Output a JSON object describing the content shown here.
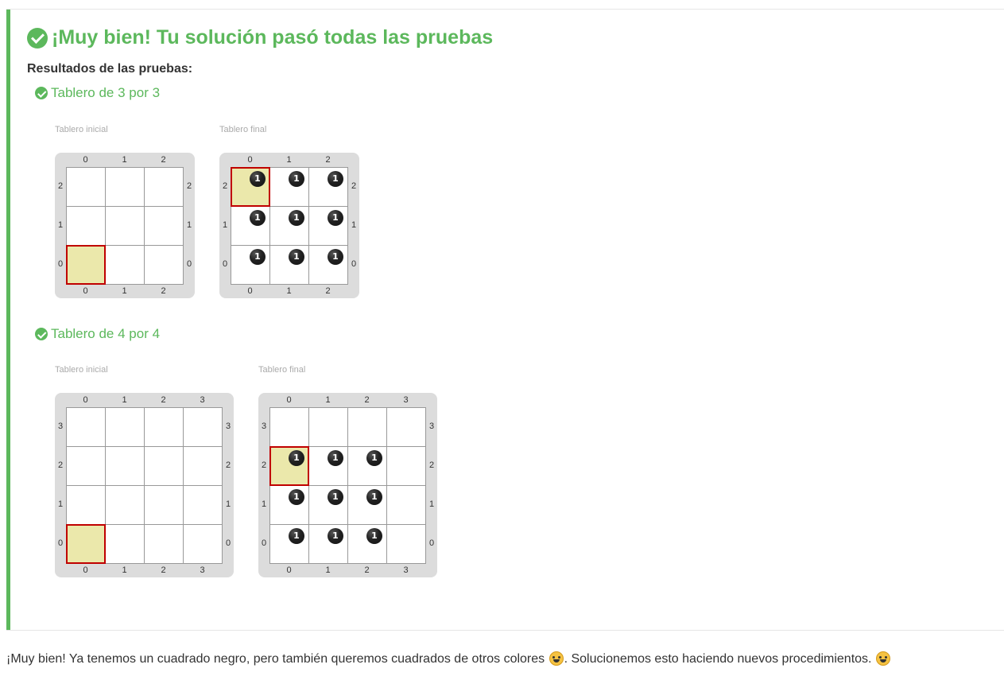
{
  "result": {
    "title": "¡Muy bien! Tu solución pasó todas las pruebas",
    "results_heading": "Resultados de las pruebas:",
    "accent_color": "#5cb85c"
  },
  "tests": [
    {
      "title": "Tablero de 3 por 3",
      "initial_label": "Tablero inicial",
      "final_label": "Tablero final",
      "size": 3,
      "initial_board": {
        "head": [
          0,
          0
        ],
        "balls": []
      },
      "final_board": {
        "head": [
          0,
          2
        ],
        "balls": [
          [
            0,
            2
          ],
          [
            1,
            2
          ],
          [
            2,
            2
          ],
          [
            0,
            1
          ],
          [
            1,
            1
          ],
          [
            2,
            1
          ],
          [
            0,
            0
          ],
          [
            1,
            0
          ],
          [
            2,
            0
          ]
        ],
        "ball_count": "1"
      }
    },
    {
      "title": "Tablero de 4 por 4",
      "initial_label": "Tablero inicial",
      "final_label": "Tablero final",
      "size": 4,
      "initial_board": {
        "head": [
          0,
          0
        ],
        "balls": []
      },
      "final_board": {
        "head": [
          0,
          2
        ],
        "balls": [
          [
            0,
            2
          ],
          [
            1,
            2
          ],
          [
            2,
            2
          ],
          [
            0,
            1
          ],
          [
            1,
            1
          ],
          [
            2,
            1
          ],
          [
            0,
            0
          ],
          [
            1,
            0
          ],
          [
            2,
            0
          ]
        ],
        "ball_count": "1"
      }
    }
  ],
  "colors": {
    "head_cell": "#ebe8ab",
    "head_border": "#c00000",
    "board_frame": "#dcdcdc"
  },
  "footer": {
    "text_before": "¡Muy bien! Ya tenemos un cuadrado negro, pero también queremos cuadrados de otros colores ",
    "emoji_1": "grinning-sweat-emoji",
    "text_middle": ". Solucionemos esto haciendo nuevos procedimientos. ",
    "emoji_2": "smirk-emoji"
  }
}
